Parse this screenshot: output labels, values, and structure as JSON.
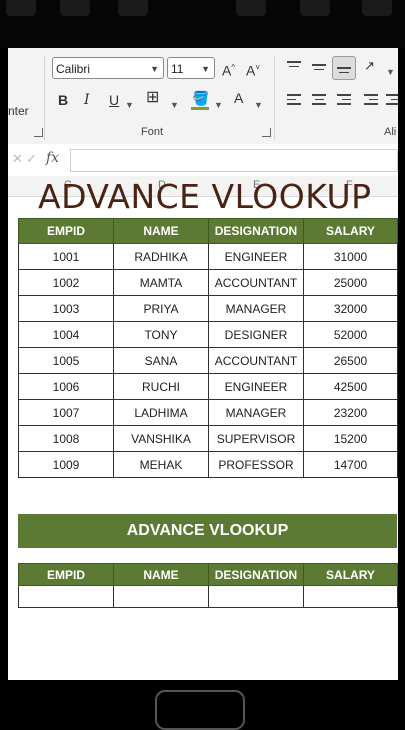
{
  "ribbon": {
    "partial_label": "nter",
    "font_name": "Calibri",
    "font_size": "11",
    "group_font": "Font",
    "group_alignment_partial": "Ali",
    "bold": "B",
    "italic": "I",
    "underline": "U",
    "grow": "A^",
    "shrink": "A˅",
    "font_color_letter": "A"
  },
  "formula_bar": {
    "cancel": "✕",
    "enter": "✓",
    "fx": "fx",
    "value": ""
  },
  "columns": [
    "C",
    "D",
    "E",
    "F"
  ],
  "sheet_title": "ADVANCE VLOOKUP",
  "table1": {
    "headers": [
      "EMPID",
      "NAME",
      "DESIGNATION",
      "SALARY"
    ],
    "rows": [
      [
        "1001",
        "RADHIKA",
        "ENGINEER",
        "31000"
      ],
      [
        "1002",
        "MAMTA",
        "ACCOUNTANT",
        "25000"
      ],
      [
        "1003",
        "PRIYA",
        "MANAGER",
        "32000"
      ],
      [
        "1004",
        "TONY",
        "DESIGNER",
        "52000"
      ],
      [
        "1005",
        "SANA",
        "ACCOUNTANT",
        "26500"
      ],
      [
        "1006",
        "RUCHI",
        "ENGINEER",
        "42500"
      ],
      [
        "1007",
        "LADHIMA",
        "MANAGER",
        "23200"
      ],
      [
        "1008",
        "VANSHIKA",
        "SUPERVISOR",
        "15200"
      ],
      [
        "1009",
        "MEHAK",
        "PROFESSOR",
        "14700"
      ]
    ]
  },
  "banner": "ADVANCE VLOOKUP",
  "table2": {
    "headers": [
      "EMPID",
      "NAME",
      "DESIGNATION",
      "SALARY"
    ],
    "row": [
      "",
      "",
      "",
      ""
    ]
  },
  "colors": {
    "header_green": "#5c7a33",
    "title_brown": "#4a2412"
  }
}
